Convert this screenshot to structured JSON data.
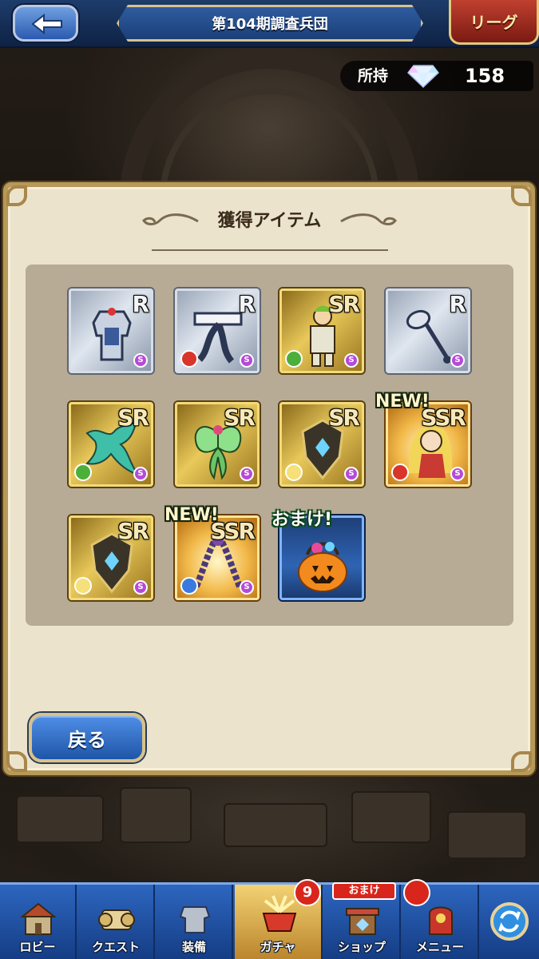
{
  "header": {
    "title": "第104期調査兵団",
    "back_icon": "back-arrow-icon",
    "league_label": "リーグ"
  },
  "currency": {
    "label": "所持",
    "icon": "gem-icon",
    "value": "158"
  },
  "panel": {
    "title": "獲得アイテム",
    "items": [
      {
        "rarity": "R",
        "art": "armor-icon",
        "element": "none",
        "tag": ""
      },
      {
        "rarity": "R",
        "art": "headband-icon",
        "element": "fire",
        "tag": ""
      },
      {
        "rarity": "SR",
        "art": "knight-character-icon",
        "element": "wind",
        "tag": ""
      },
      {
        "rarity": "R",
        "art": "spoon-icon",
        "element": "none",
        "tag": ""
      },
      {
        "rarity": "SR",
        "art": "dragon-icon",
        "element": "wind",
        "tag": ""
      },
      {
        "rarity": "SR",
        "art": "moth-icon",
        "element": "none",
        "tag": ""
      },
      {
        "rarity": "SR",
        "art": "shield-icon",
        "element": "light",
        "tag": ""
      },
      {
        "rarity": "SSR",
        "art": "princess-character-icon",
        "element": "fire",
        "tag": "NEW!"
      },
      {
        "rarity": "SR",
        "art": "shield-icon",
        "element": "light",
        "tag": ""
      },
      {
        "rarity": "SSR",
        "art": "flail-icon",
        "element": "water",
        "tag": "NEW!"
      },
      {
        "rarity": "",
        "art": "pumpkin-basket-icon",
        "element": "none",
        "tag": "おまけ!"
      }
    ],
    "return_label": "戻る"
  },
  "nav": {
    "items": [
      {
        "label": "ロビー",
        "icon": "lobby-icon"
      },
      {
        "label": "クエスト",
        "icon": "quest-icon"
      },
      {
        "label": "装備",
        "icon": "equipment-icon"
      },
      {
        "label": "ガチャ",
        "icon": "gacha-icon"
      },
      {
        "label": "ショップ",
        "icon": "shop-icon"
      },
      {
        "label": "メニュー",
        "icon": "menu-icon"
      },
      {
        "label": "",
        "icon": "refresh-icon"
      }
    ],
    "gacha_badge": "9",
    "shop_badge": "おまけ"
  },
  "colors": {
    "header_blue": "#1d3c6b",
    "panel_cream": "#ece3cc",
    "gold": "#e9c95a",
    "nav_blue": "#2d66c0",
    "badge_red": "#d9261c"
  }
}
